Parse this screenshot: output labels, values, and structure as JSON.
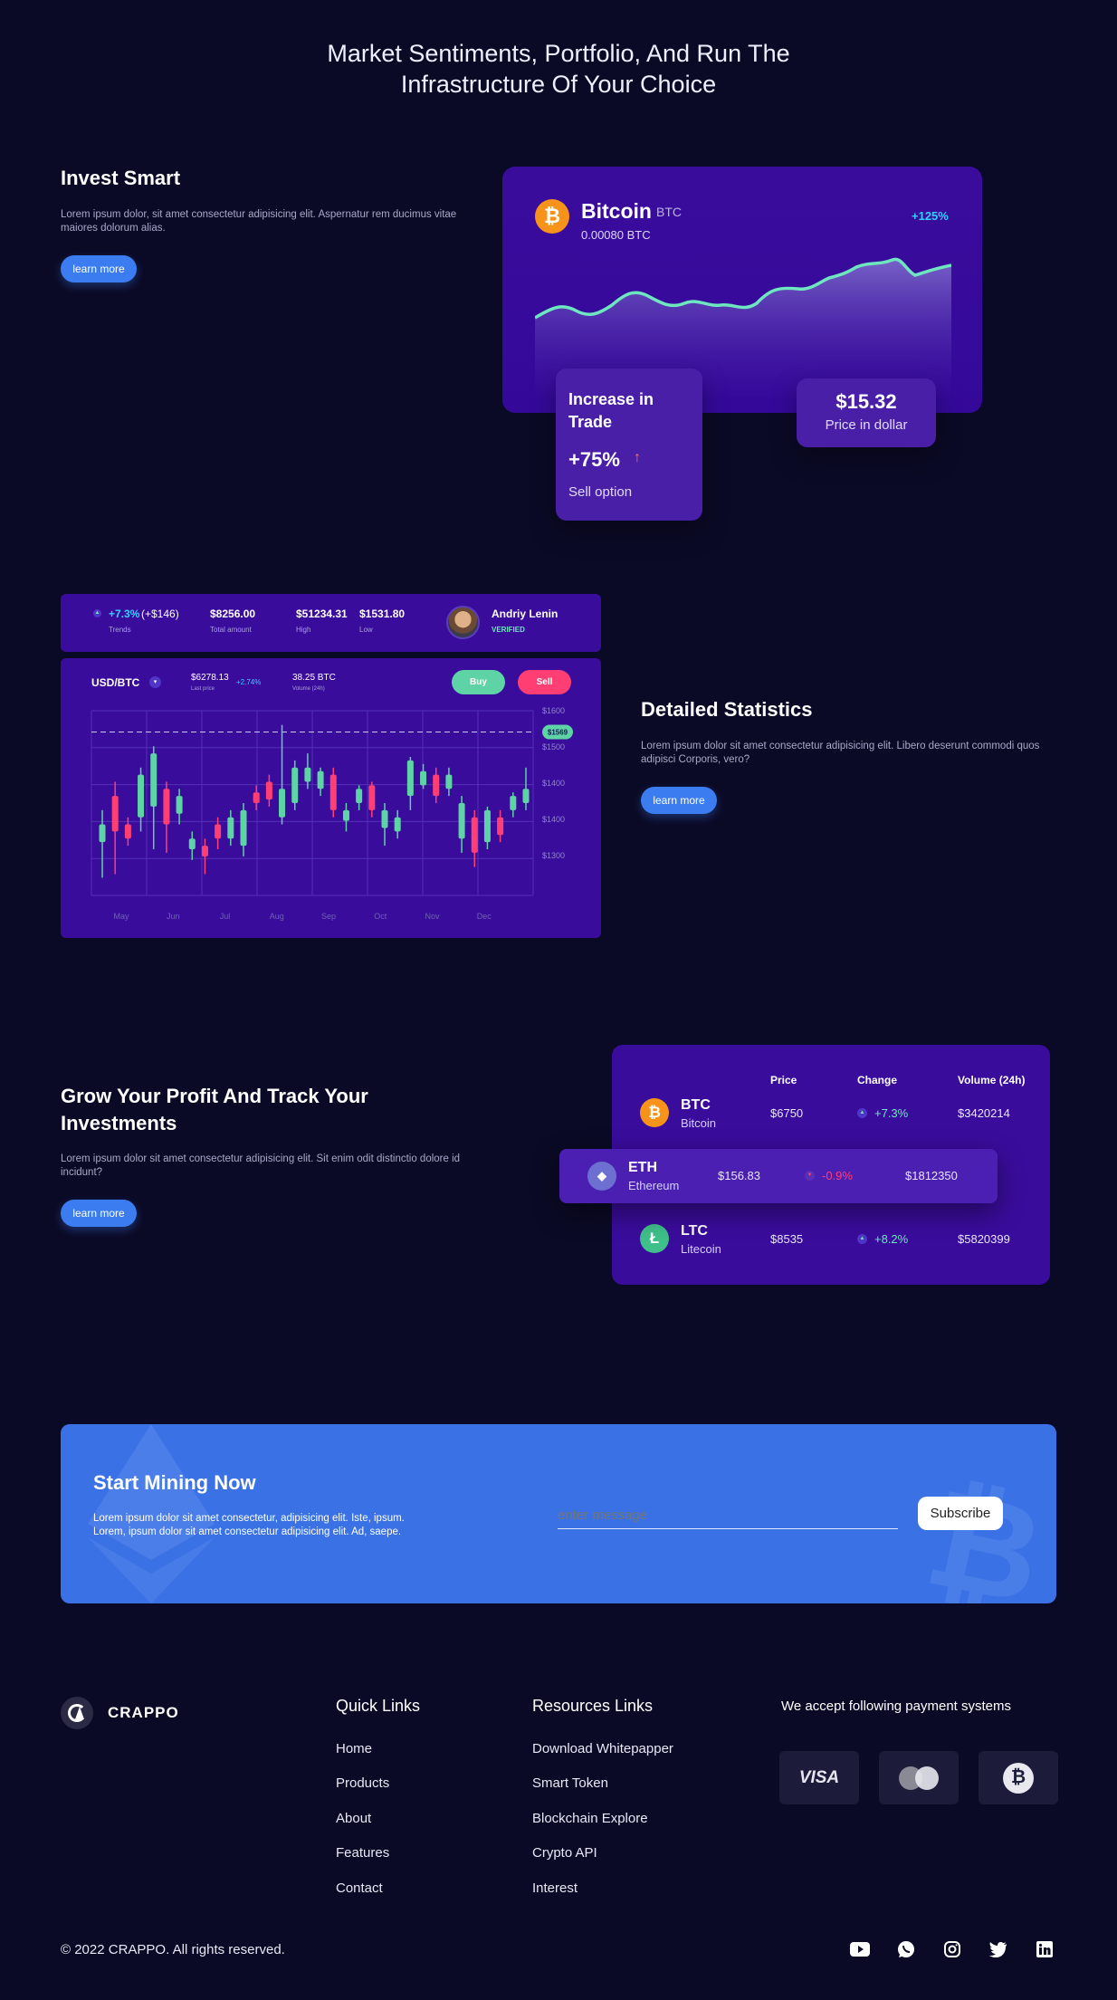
{
  "hero": {
    "title_line1": "Market Sentiments, Portfolio, And Run The",
    "title_line2": "Infrastructure Of Your Choice"
  },
  "invest": {
    "title": "Invest Smart",
    "text": "Lorem ipsum dolor, sit amet consectetur adipisicing elit. Aspernatur rem ducimus vitae maiores dolorum alias.",
    "button": "learn more",
    "card": {
      "coin_name": "Bitcoin",
      "coin_symbol": "BTC",
      "amount": "0.00080 BTC",
      "change": "+125%",
      "coin_glyph": "₿",
      "trade_title": "Increase in Trade",
      "trade_value": "+75%",
      "trade_sub": "Sell option",
      "price": "$15.32",
      "price_label": "Price in dollar"
    }
  },
  "stats": {
    "title": "Detailed Statistics",
    "text": "Lorem ipsum dolor sit amet consectetur adipisicing elit. Libero deserunt commodi quos adipisci Corporis, vero?",
    "button": "learn more",
    "top": {
      "trend_value": "+7.3%",
      "trend_extra": "(+$146)",
      "trend_label": "Trends",
      "total": "$8256.00",
      "total_label": "Total amount",
      "high": "$51234.31",
      "high_label": "High",
      "low": "$1531.80",
      "low_label": "Low",
      "user_name": "Andriy Lenin",
      "user_status": "VERIFIED"
    },
    "panel": {
      "pair": "USD/BTC",
      "last_price": "$6278.13",
      "last_price_label": "Last price",
      "last_change": "+2.74%",
      "volume": "38.25 BTC",
      "volume_label": "Volume (24h)",
      "buy": "Buy",
      "sell": "Sell",
      "current_tag": "$1569"
    }
  },
  "chart_data": {
    "type": "candlestick",
    "x_labels": [
      "May",
      "Jun",
      "Jul",
      "Aug",
      "Sep",
      "Oct",
      "Nov",
      "Dec"
    ],
    "y_labels": [
      "$1600",
      "$1500",
      "$1400",
      "$1400",
      "$1300"
    ],
    "candles": [
      {
        "o": 1420,
        "c": 1395,
        "h": 1440,
        "l": 1345,
        "up": true
      },
      {
        "o": 1410,
        "c": 1460,
        "h": 1480,
        "l": 1350,
        "up": false
      },
      {
        "o": 1420,
        "c": 1400,
        "h": 1430,
        "l": 1390,
        "up": false
      },
      {
        "o": 1430,
        "c": 1490,
        "h": 1500,
        "l": 1410,
        "up": true
      },
      {
        "o": 1445,
        "c": 1520,
        "h": 1530,
        "l": 1385,
        "up": true
      },
      {
        "o": 1470,
        "c": 1420,
        "h": 1480,
        "l": 1380,
        "up": false
      },
      {
        "o": 1435,
        "c": 1460,
        "h": 1470,
        "l": 1420,
        "up": true
      },
      {
        "o": 1385,
        "c": 1400,
        "h": 1410,
        "l": 1370,
        "up": true
      },
      {
        "o": 1390,
        "c": 1375,
        "h": 1400,
        "l": 1350,
        "up": false
      },
      {
        "o": 1400,
        "c": 1420,
        "h": 1430,
        "l": 1385,
        "up": false
      },
      {
        "o": 1400,
        "c": 1430,
        "h": 1440,
        "l": 1390,
        "up": true
      },
      {
        "o": 1390,
        "c": 1440,
        "h": 1450,
        "l": 1375,
        "up": true
      },
      {
        "o": 1450,
        "c": 1465,
        "h": 1475,
        "l": 1440,
        "up": false
      },
      {
        "o": 1455,
        "c": 1480,
        "h": 1490,
        "l": 1445,
        "up": false
      },
      {
        "o": 1430,
        "c": 1470,
        "h": 1560,
        "l": 1420,
        "up": true
      },
      {
        "o": 1450,
        "c": 1500,
        "h": 1510,
        "l": 1440,
        "up": true
      },
      {
        "o": 1480,
        "c": 1500,
        "h": 1520,
        "l": 1470,
        "up": true
      },
      {
        "o": 1470,
        "c": 1495,
        "h": 1500,
        "l": 1460,
        "up": true
      },
      {
        "o": 1490,
        "c": 1440,
        "h": 1500,
        "l": 1430,
        "up": false
      },
      {
        "o": 1425,
        "c": 1440,
        "h": 1450,
        "l": 1410,
        "up": true
      },
      {
        "o": 1450,
        "c": 1470,
        "h": 1475,
        "l": 1440,
        "up": true
      },
      {
        "o": 1475,
        "c": 1440,
        "h": 1480,
        "l": 1430,
        "up": false
      },
      {
        "o": 1415,
        "c": 1440,
        "h": 1450,
        "l": 1390,
        "up": true
      },
      {
        "o": 1410,
        "c": 1430,
        "h": 1440,
        "l": 1400,
        "up": true
      },
      {
        "o": 1460,
        "c": 1510,
        "h": 1515,
        "l": 1440,
        "up": true
      },
      {
        "o": 1475,
        "c": 1495,
        "h": 1505,
        "l": 1470,
        "up": true
      },
      {
        "o": 1490,
        "c": 1460,
        "h": 1500,
        "l": 1450,
        "up": false
      },
      {
        "o": 1470,
        "c": 1490,
        "h": 1500,
        "l": 1460,
        "up": true
      },
      {
        "o": 1400,
        "c": 1450,
        "h": 1460,
        "l": 1380,
        "up": true
      },
      {
        "o": 1430,
        "c": 1380,
        "h": 1440,
        "l": 1360,
        "up": false
      },
      {
        "o": 1395,
        "c": 1440,
        "h": 1445,
        "l": 1385,
        "up": true
      },
      {
        "o": 1430,
        "c": 1405,
        "h": 1440,
        "l": 1395,
        "up": false
      },
      {
        "o": 1440,
        "c": 1460,
        "h": 1465,
        "l": 1430,
        "up": true
      },
      {
        "o": 1450,
        "c": 1470,
        "h": 1500,
        "l": 1440,
        "up": true
      }
    ]
  },
  "track": {
    "title_line1": "Grow Your Profit And Track Your",
    "title_line2": "Investments",
    "text": "Lorem ipsum dolor sit amet consectetur adipisicing elit. Sit enim odit distinctio dolore id incidunt?",
    "button": "learn more",
    "headers": [
      "Price",
      "Change",
      "Volume (24h)"
    ],
    "rows": [
      {
        "symbol": "BTC",
        "name": "Bitcoin",
        "price": "$6750",
        "change": "+7.3%",
        "volume": "$3420214",
        "glyph": "₿",
        "color": "#f7931a"
      },
      {
        "symbol": "ETH",
        "name": "Ethereum",
        "price": "$156.83",
        "change": "-0.9%",
        "volume": "$1812350",
        "glyph": "◆",
        "color": "#6d6fd1"
      },
      {
        "symbol": "LTC",
        "name": "Litecoin",
        "price": "$8535",
        "change": "+8.2%",
        "volume": "$5820399",
        "glyph": "Ł",
        "color": "#3fbf8a"
      }
    ]
  },
  "mining": {
    "title": "Start Mining Now",
    "text_line1": "Lorem ipsum dolor sit amet consectetur, adipisicing elit. Iste, ipsum.",
    "text_line2": "Lorem, ipsum dolor sit amet consectetur adipisicing elit. Ad, saepe.",
    "placeholder": "enter message",
    "button": "Subscribe"
  },
  "footer": {
    "brand": "CRAPPO",
    "quick_title": "Quick Links",
    "quick_links": [
      "Home",
      "Products",
      "About",
      "Features",
      "Contact"
    ],
    "res_title": "Resources Links",
    "res_links": [
      "Download Whitepapper",
      "Smart Token",
      "Blockchain Explore",
      "Crypto API",
      "Interest"
    ],
    "pay_title": "We accept following payment systems",
    "pay_visa": "VISA",
    "copyright": "© 2022 CRAPPO. All rights reserved."
  },
  "colors": {
    "bg": "#0b0a26",
    "card": "#3a0c9c",
    "accent_blue": "#3b7df1",
    "green": "#5ed3a5",
    "red": "#ff3f74",
    "cyan": "#35d0ff"
  }
}
